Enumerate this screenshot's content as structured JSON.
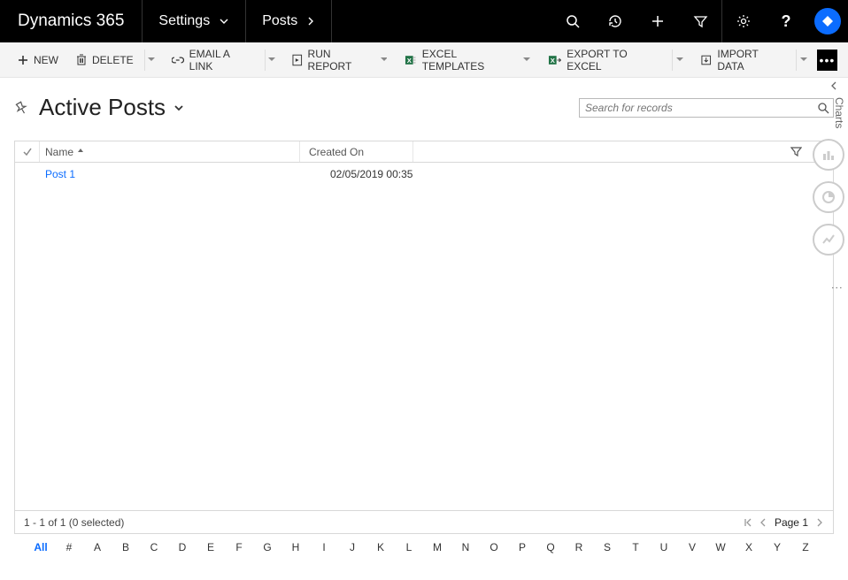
{
  "topnav": {
    "brand": "Dynamics 365",
    "area": "Settings",
    "entity": "Posts"
  },
  "commands": {
    "new": "NEW",
    "delete": "DELETE",
    "email_link": "EMAIL A LINK",
    "run_report": "RUN REPORT",
    "excel_templates": "EXCEL TEMPLATES",
    "export_excel": "EXPORT TO EXCEL",
    "import_data": "IMPORT DATA"
  },
  "view": {
    "title": "Active Posts",
    "search_placeholder": "Search for records"
  },
  "grid": {
    "columns": {
      "name": "Name",
      "created_on": "Created On"
    },
    "rows": [
      {
        "name": "Post 1",
        "created_on": "02/05/2019 00:35"
      }
    ],
    "footer_status": "1 - 1 of 1 (0 selected)",
    "page_label": "Page 1"
  },
  "alpha": {
    "all": "All",
    "letters": [
      "#",
      "A",
      "B",
      "C",
      "D",
      "E",
      "F",
      "G",
      "H",
      "I",
      "J",
      "K",
      "L",
      "M",
      "N",
      "O",
      "P",
      "Q",
      "R",
      "S",
      "T",
      "U",
      "V",
      "W",
      "X",
      "Y",
      "Z"
    ]
  },
  "side": {
    "charts": "Charts"
  }
}
